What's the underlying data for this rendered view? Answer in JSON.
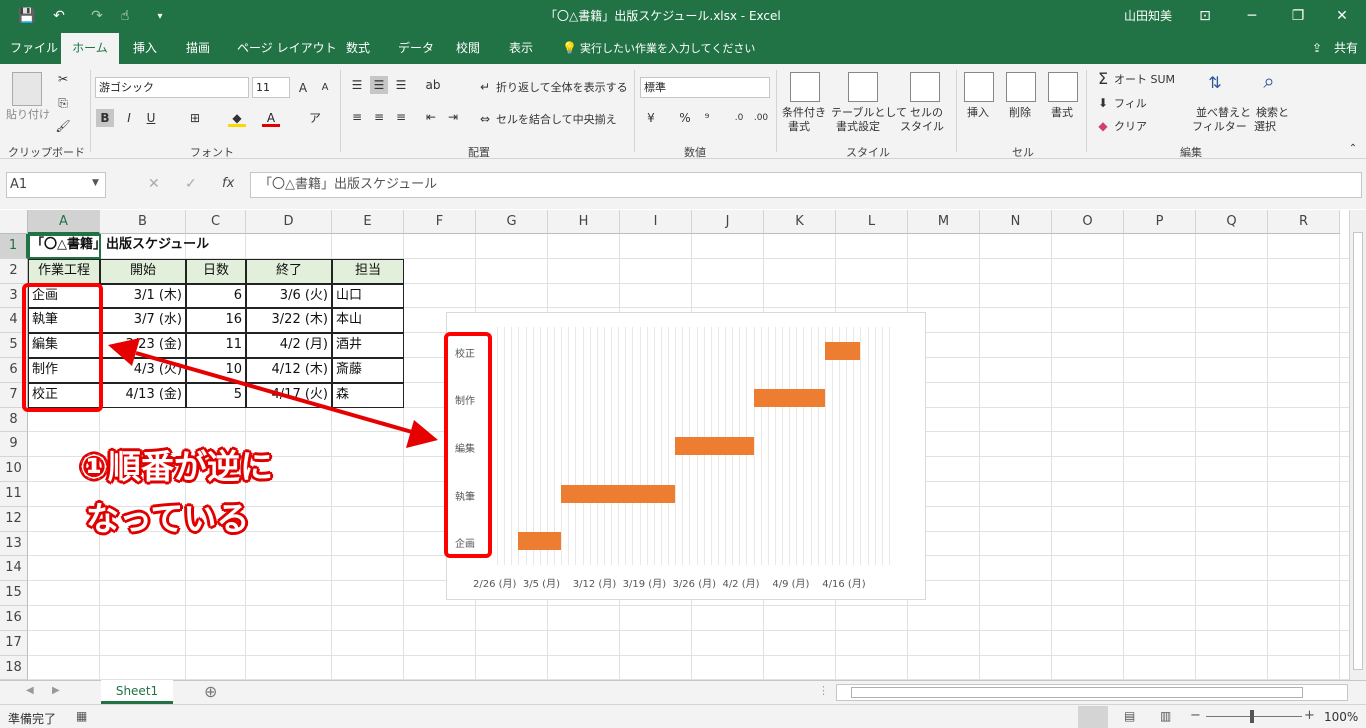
{
  "titlebar": {
    "title": "「〇△書籍」出版スケジュール.xlsx  -  Excel",
    "user": "山田知美",
    "qat_save": "💾",
    "qat_undo": "↶",
    "qat_redo": "↷",
    "qat_touch": "☝",
    "min": "─",
    "max": "❐",
    "close": "✕",
    "ribbon_opts": "⊡"
  },
  "tabs": {
    "file": "ファイル",
    "home": "ホーム",
    "insert": "挿入",
    "draw": "描画",
    "layout": "ページ レイアウト",
    "formulas": "数式",
    "data": "データ",
    "review": "校閲",
    "view": "表示",
    "tell": "実行したい作業を入力してください",
    "share": "共有"
  },
  "ribbon": {
    "paste": "貼り付け",
    "font_name": "游ゴシック",
    "font_size": "11",
    "bold": "B",
    "italic": "I",
    "underline": "U",
    "wrap_text": "折り返して全体を表示する",
    "merge_center": "セルを結合して中央揃え",
    "number_format": "標準",
    "percent": "%",
    "comma": "⁹",
    "cond_format_1": "条件付き",
    "cond_format_2": "書式",
    "table_format_1": "テーブルとして",
    "table_format_2": "書式設定",
    "cell_style_1": "セルの",
    "cell_style_2": "スタイル",
    "insert": "挿入",
    "delete": "削除",
    "format": "書式",
    "autosum": "オート SUM",
    "fill": "フィル",
    "clear": "クリア",
    "sort_1": "並べ替えと",
    "sort_2": "フィルター",
    "find_1": "検索と",
    "find_2": "選択",
    "groups": {
      "clipboard": "クリップボード",
      "font": "フォント",
      "alignment": "配置",
      "number": "数値",
      "styles": "スタイル",
      "cells": "セル",
      "editing": "編集"
    }
  },
  "formula": {
    "name_box": "A1",
    "fx": "fx",
    "content": "「〇△書籍」出版スケジュール"
  },
  "columns": [
    "A",
    "B",
    "C",
    "D",
    "E",
    "F",
    "G",
    "H",
    "I",
    "J",
    "K",
    "L",
    "M",
    "N",
    "O",
    "P",
    "Q",
    "R"
  ],
  "rows": [
    "1",
    "2",
    "3",
    "4",
    "5",
    "6",
    "7",
    "8",
    "9",
    "10",
    "11",
    "12",
    "13",
    "14",
    "15",
    "16",
    "17",
    "18"
  ],
  "sheet": {
    "title": "「〇△書籍」出版スケジュール",
    "headers": [
      "作業工程",
      "開始",
      "日数",
      "終了",
      "担当"
    ],
    "data": [
      [
        "企画",
        "3/1 (木)",
        "6",
        "3/6 (火)",
        "山口"
      ],
      [
        "執筆",
        "3/7 (水)",
        "16",
        "3/22 (木)",
        "本山"
      ],
      [
        "編集",
        "3/23 (金)",
        "11",
        "4/2 (月)",
        "酒井"
      ],
      [
        "制作",
        "4/3 (火)",
        "10",
        "4/12 (木)",
        "斎藤"
      ],
      [
        "校正",
        "4/13 (金)",
        "5",
        "4/17 (火)",
        "森"
      ]
    ]
  },
  "chart_data": {
    "type": "bar",
    "orientation": "horizontal",
    "subtype": "gantt",
    "categories_top_to_bottom": [
      "校正",
      "制作",
      "編集",
      "執筆",
      "企画"
    ],
    "series": [
      {
        "category": "企画",
        "start": "3/1",
        "end": "3/6"
      },
      {
        "category": "執筆",
        "start": "3/7",
        "end": "3/22"
      },
      {
        "category": "編集",
        "start": "3/23",
        "end": "4/2"
      },
      {
        "category": "制作",
        "start": "4/3",
        "end": "4/12"
      },
      {
        "category": "校正",
        "start": "4/13",
        "end": "4/17"
      }
    ],
    "x_tick_labels": [
      "2/26 (月)",
      "3/5 (月)",
      "3/12 (月)",
      "3/19 (月)",
      "3/26 (月)",
      "4/2 (月)",
      "4/9 (月)",
      "4/16 (月)"
    ],
    "bar_color": "#ED7D31",
    "grid": true
  },
  "annotation": {
    "line1": "①順番が逆に",
    "line2": "なっている",
    "color": "#FF0000"
  },
  "sheet_tabs": {
    "active": "Sheet1",
    "add": "⊕"
  },
  "status": {
    "ready": "準備完了",
    "zoom": "100%"
  }
}
